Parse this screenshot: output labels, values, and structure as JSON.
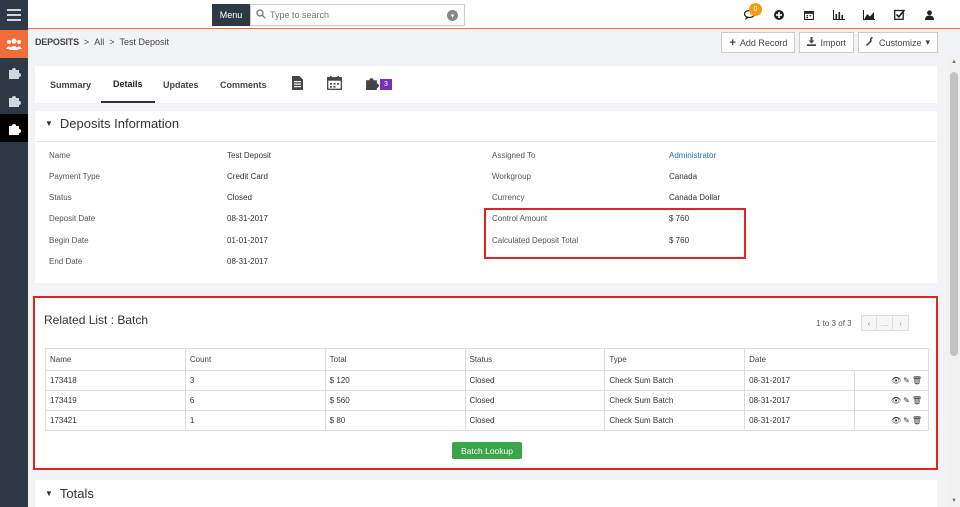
{
  "topbar": {
    "menu_label": "Menu",
    "search_placeholder": "Type to search",
    "notifications_count": "0",
    "icons": [
      "chat-icon",
      "plus-circle-icon",
      "calendar-icon",
      "bar-chart-icon",
      "area-chart-icon",
      "checkbox-icon",
      "user-icon"
    ]
  },
  "breadcrumb": {
    "module": "DEPOSITS",
    "sep1": ">",
    "all": "All",
    "sep2": ">",
    "current": "Test Deposit"
  },
  "actions": {
    "add_record": "Add Record",
    "import": "Import",
    "customize": "Customize"
  },
  "tabs": {
    "summary": "Summary",
    "details": "Details",
    "updates": "Updates",
    "comments": "Comments",
    "plugin_count": "3"
  },
  "deposit_info": {
    "title": "Deposits Information",
    "left": [
      {
        "label": "Name",
        "value": "Test Deposit"
      },
      {
        "label": "Payment Type",
        "value": "Credit Card"
      },
      {
        "label": "Status",
        "value": "Closed"
      },
      {
        "label": "Deposit Date",
        "value": "08-31-2017"
      },
      {
        "label": "Begin Date",
        "value": "01-01-2017"
      },
      {
        "label": "End Date",
        "value": "08-31-2017"
      }
    ],
    "right": [
      {
        "label": "Assigned To",
        "value": "Administrator"
      },
      {
        "label": "Workgroup",
        "value": "Canada"
      },
      {
        "label": "Currency",
        "value": "Canada Dollar"
      },
      {
        "label": "Control Amount",
        "value": "$ 760"
      },
      {
        "label": "Calculated Deposit Total",
        "value": "$ 760"
      }
    ]
  },
  "related": {
    "title": "Related List : Batch",
    "pager": "1 to 3 of 3",
    "columns": [
      "Name",
      "Count",
      "Total",
      "Status",
      "Type",
      "Date"
    ],
    "rows": [
      [
        "173418",
        "3",
        "$ 120",
        "Closed",
        "Check Sum Batch",
        "08-31-2017"
      ],
      [
        "173419",
        "6",
        "$ 560",
        "Closed",
        "Check Sum Batch",
        "08-31-2017"
      ],
      [
        "173421",
        "1",
        "$ 80",
        "Closed",
        "Check Sum Batch",
        "08-31-2017"
      ]
    ],
    "lookup_button": "Batch Lookup"
  },
  "totals": {
    "title": "Totals"
  },
  "colors": {
    "accent": "#f26b3a",
    "rail": "#2d3a46",
    "highlight": "#e02424",
    "button_green": "#3aa54a",
    "link": "#2a6db2"
  }
}
